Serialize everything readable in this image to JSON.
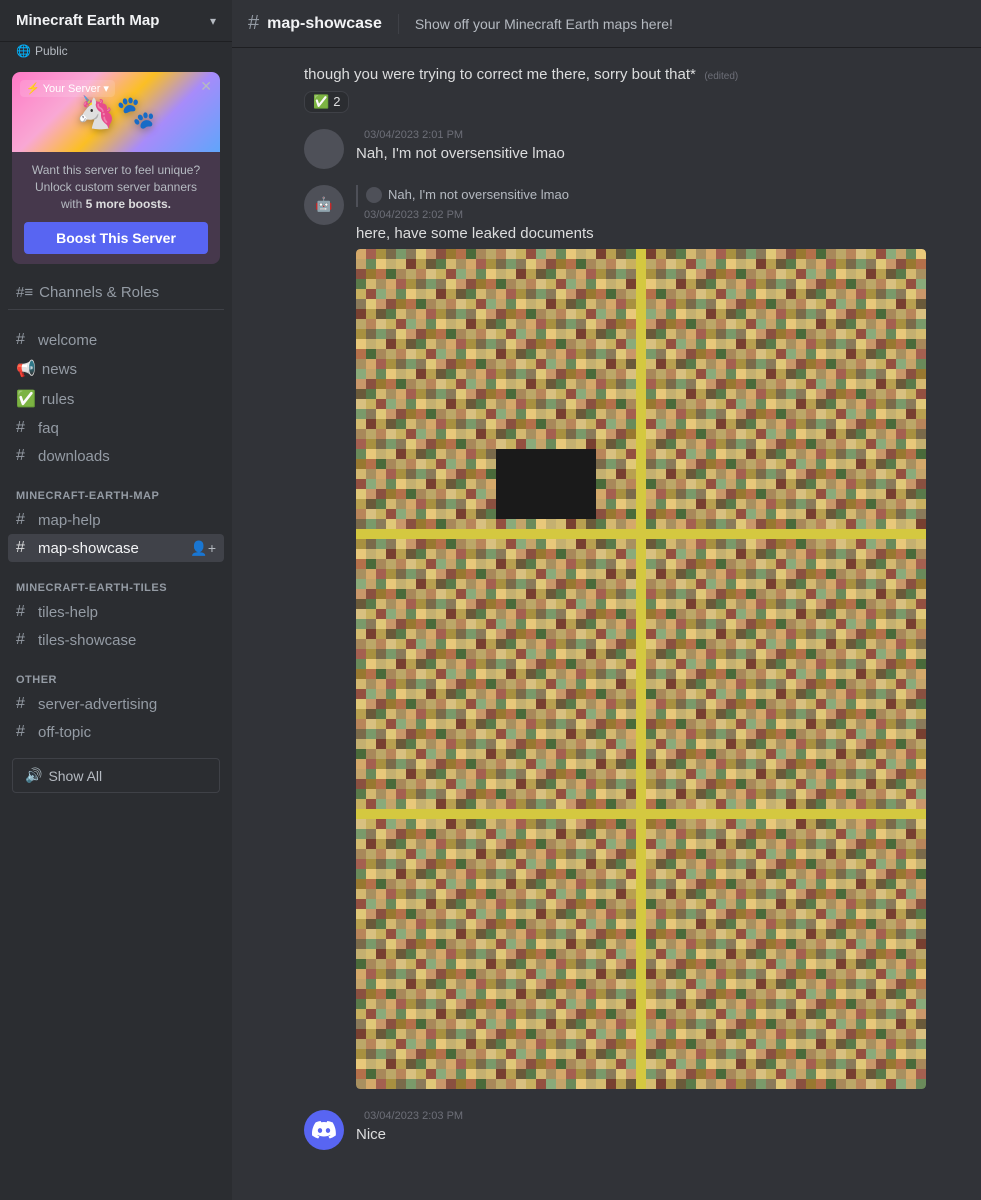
{
  "server": {
    "name": "Minecraft Earth Map",
    "badge": "Public"
  },
  "boost_card": {
    "label": "Your Server",
    "text_line1": "Want this server to feel unique?",
    "text_line2": "Unlock custom server banners",
    "text_bold": "5 more boosts.",
    "button": "Boost This Server"
  },
  "sidebar": {
    "channels_roles": "Channels & Roles",
    "general_channels": [
      {
        "name": "welcome",
        "icon": "#"
      },
      {
        "name": "news",
        "icon": "📢"
      },
      {
        "name": "rules",
        "icon": "✅"
      },
      {
        "name": "faq",
        "icon": "#"
      },
      {
        "name": "downloads",
        "icon": "#"
      }
    ],
    "section_minecraft_earth_map": "MINECRAFT-EARTH-MAP",
    "map_channels": [
      {
        "name": "map-help",
        "icon": "#"
      },
      {
        "name": "map-showcase",
        "icon": "#",
        "active": true
      }
    ],
    "section_minecraft_earth_tiles": "MINECRAFT-EARTH-TILES",
    "tiles_channels": [
      {
        "name": "tiles-help",
        "icon": "#"
      },
      {
        "name": "tiles-showcase",
        "icon": "#"
      }
    ],
    "section_other": "OTHER",
    "other_channels": [
      {
        "name": "server-advertising",
        "icon": "#"
      },
      {
        "name": "off-topic",
        "icon": "#"
      }
    ],
    "show_all": "Show All"
  },
  "channel": {
    "name": "map-showcase",
    "description": "Show off your Minecraft Earth maps here!"
  },
  "messages": [
    {
      "id": "msg1",
      "type": "continuation",
      "content": "though you were trying to correct me there, sorry bout that*",
      "edited": true,
      "reactions": [
        {
          "emoji": "✅",
          "count": "2"
        }
      ]
    },
    {
      "id": "msg2",
      "type": "full",
      "username": "",
      "timestamp": "03/04/2023 2:01 PM",
      "content": "Nah, I'm not oversensitive lmao"
    },
    {
      "id": "msg3",
      "type": "full_with_quote",
      "username": "",
      "timestamp": "03/04/2023 2:02 PM",
      "quote_text": "Nah, I'm not oversensitive lmao",
      "content": "here, have some leaked documents",
      "has_image": true
    },
    {
      "id": "msg4",
      "type": "full",
      "username": "",
      "timestamp": "03/04/2023 2:03 PM",
      "content": "Nice",
      "avatar_type": "discord"
    }
  ]
}
